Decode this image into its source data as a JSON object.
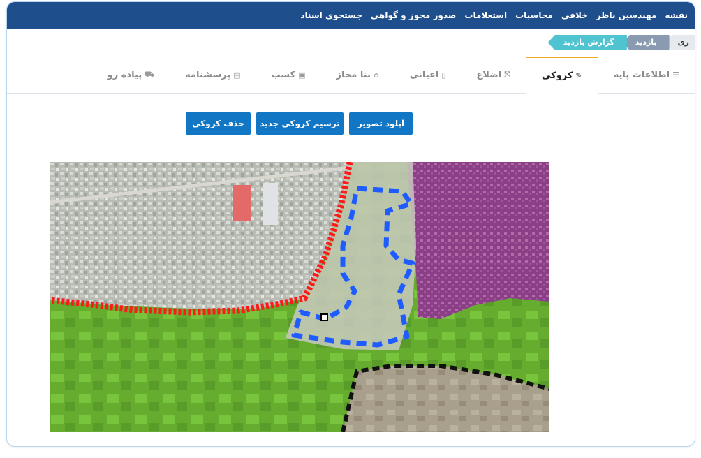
{
  "top_nav": {
    "items": [
      "نقشه",
      "مهندسین ناظر",
      "خلافی",
      "محاسبات",
      "استعلامات",
      "صدور مجوز و گواهی",
      "جستجوی اسناد"
    ]
  },
  "breadcrumb": {
    "items": [
      "ری",
      "بازدید",
      "گزارش بازدید"
    ]
  },
  "tabs": [
    {
      "label": "اطلاعات پایه",
      "icon": "list-icon"
    },
    {
      "label": "کروکی",
      "icon": "edit-icon",
      "active": true
    },
    {
      "label": "اضلاع",
      "icon": "expand-icon"
    },
    {
      "label": "اعیانی",
      "icon": "mobile-icon"
    },
    {
      "label": "بنا مجاز",
      "icon": "home-icon"
    },
    {
      "label": "کسب",
      "icon": "briefcase-icon"
    },
    {
      "label": "پرسشنامه",
      "icon": "file-icon"
    },
    {
      "label": "پیاده رو",
      "icon": "road-icon"
    }
  ],
  "actions": {
    "upload": "آپلود تصویر",
    "draw": "ترسیم کروکی جدید",
    "delete": "حذف کروکی"
  },
  "colors": {
    "nav_bg": "#1f4e8c",
    "button_bg": "#1176c4",
    "active_tab_accent": "#f0a420",
    "breadcrumb_active": "#4fc3cf",
    "parcel_outline": "#1f5cff",
    "boundary_red": "#ff1a1a"
  }
}
